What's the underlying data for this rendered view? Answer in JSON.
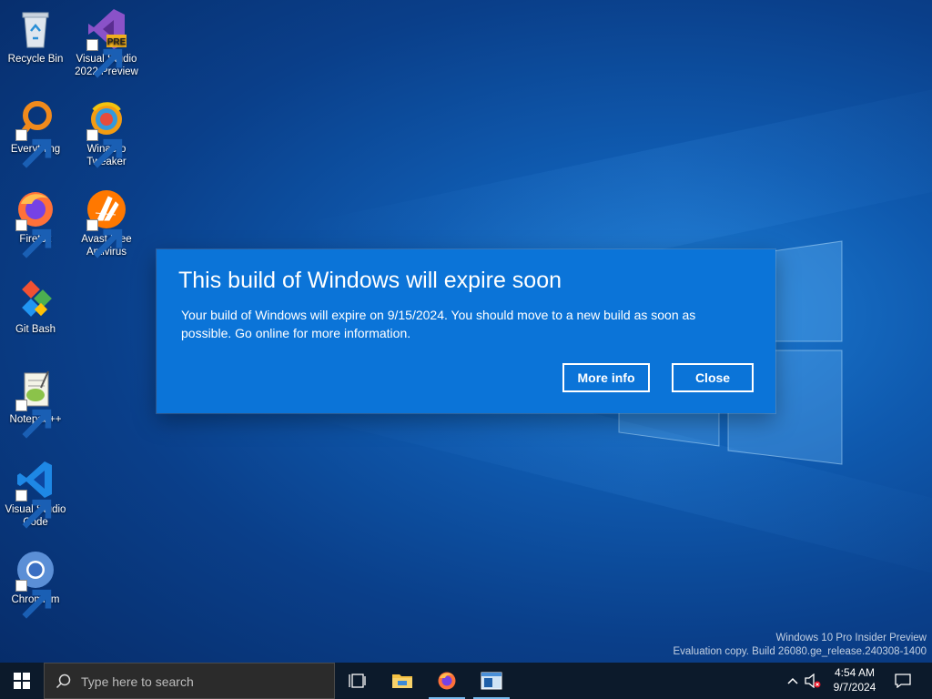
{
  "desktop": {
    "icons": [
      {
        "label": "Recycle Bin"
      },
      {
        "label": "Visual Studio 2022 Preview",
        "badge": "PRE"
      },
      {
        "label": "Everything"
      },
      {
        "label": "Winaero Tweaker"
      },
      {
        "label": "Firefox"
      },
      {
        "label": "Avast Free Antivirus"
      },
      {
        "label": "Git Bash"
      },
      {
        "label": "Notepad++"
      },
      {
        "label": "Visual Studio Code"
      },
      {
        "label": "Chromium"
      }
    ]
  },
  "dialog": {
    "title": "This build of Windows will expire soon",
    "body": "Your build of Windows will expire on 9/15/2024. You should move to a new build as soon as possible. Go online for more information.",
    "more_info_label": "More info",
    "close_label": "Close"
  },
  "watermark": {
    "line1": "Windows 10 Pro Insider Preview",
    "line2": "Evaluation copy. Build 26080.ge_release.240308-1400"
  },
  "taskbar": {
    "search_placeholder": "Type here to search",
    "apps": [
      "task-view",
      "file-explorer",
      "firefox",
      "app-window"
    ],
    "clock_time": "4:54 AM",
    "clock_date": "9/7/2024"
  },
  "colors": {
    "dialog_bg": "#0b74d8",
    "taskbar_bg": "#0c1a2b",
    "accent": "#76b9ed"
  }
}
